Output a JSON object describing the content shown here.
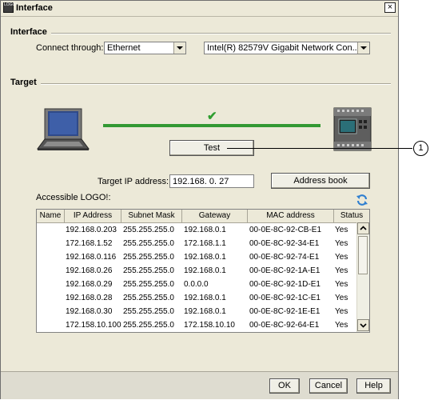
{
  "window": {
    "title": "Interface",
    "logo_text": "LOGO!",
    "close_glyph": "×"
  },
  "interface_section": {
    "label": "Interface",
    "connect_through_label": "Connect through:",
    "connect_through_value": "Ethernet",
    "adapter_value": "Intel(R) 82579V Gigabit Network Con..."
  },
  "target_section": {
    "label": "Target",
    "link_status": "connected",
    "check_glyph": "✔",
    "test_button": "Test",
    "target_ip_label": "Target IP address:",
    "target_ip_value": "192.168.  0. 27",
    "address_book_button": "Address book",
    "accessible_label": "Accessible LOGO!:",
    "callout_number": "1"
  },
  "table": {
    "columns": [
      "Name",
      "IP Address",
      "Subnet Mask",
      "Gateway",
      "MAC address",
      "Status"
    ],
    "rows": [
      [
        "",
        "192.168.0.203",
        "255.255.255.0",
        "192.168.0.1",
        "00-0E-8C-92-CB-E1",
        "Yes"
      ],
      [
        "",
        "172.168.1.52",
        "255.255.255.0",
        "172.168.1.1",
        "00-0E-8C-92-34-E1",
        "Yes"
      ],
      [
        "",
        "192.168.0.116",
        "255.255.255.0",
        "192.168.0.1",
        "00-0E-8C-92-74-E1",
        "Yes"
      ],
      [
        "",
        "192.168.0.26",
        "255.255.255.0",
        "192.168.0.1",
        "00-0E-8C-92-1A-E1",
        "Yes"
      ],
      [
        "",
        "192.168.0.29",
        "255.255.255.0",
        "0.0.0.0",
        "00-0E-8C-92-1D-E1",
        "Yes"
      ],
      [
        "",
        "192.168.0.28",
        "255.255.255.0",
        "192.168.0.1",
        "00-0E-8C-92-1C-E1",
        "Yes"
      ],
      [
        "",
        "192.168.0.30",
        "255.255.255.0",
        "192.168.0.1",
        "00-0E-8C-92-1E-E1",
        "Yes"
      ],
      [
        "",
        "172.158.10.100",
        "255.255.255.0",
        "172.158.10.10",
        "00-0E-8C-92-64-E1",
        "Yes"
      ]
    ]
  },
  "buttons": {
    "ok": "OK",
    "cancel": "Cancel",
    "help": "Help"
  },
  "colors": {
    "link_line": "#339933",
    "refresh_icon": "#2f7fd0"
  },
  "icons": {
    "laptop": "laptop-icon",
    "plc": "logo-plc-icon",
    "refresh": "refresh-icon",
    "check": "check-icon"
  }
}
